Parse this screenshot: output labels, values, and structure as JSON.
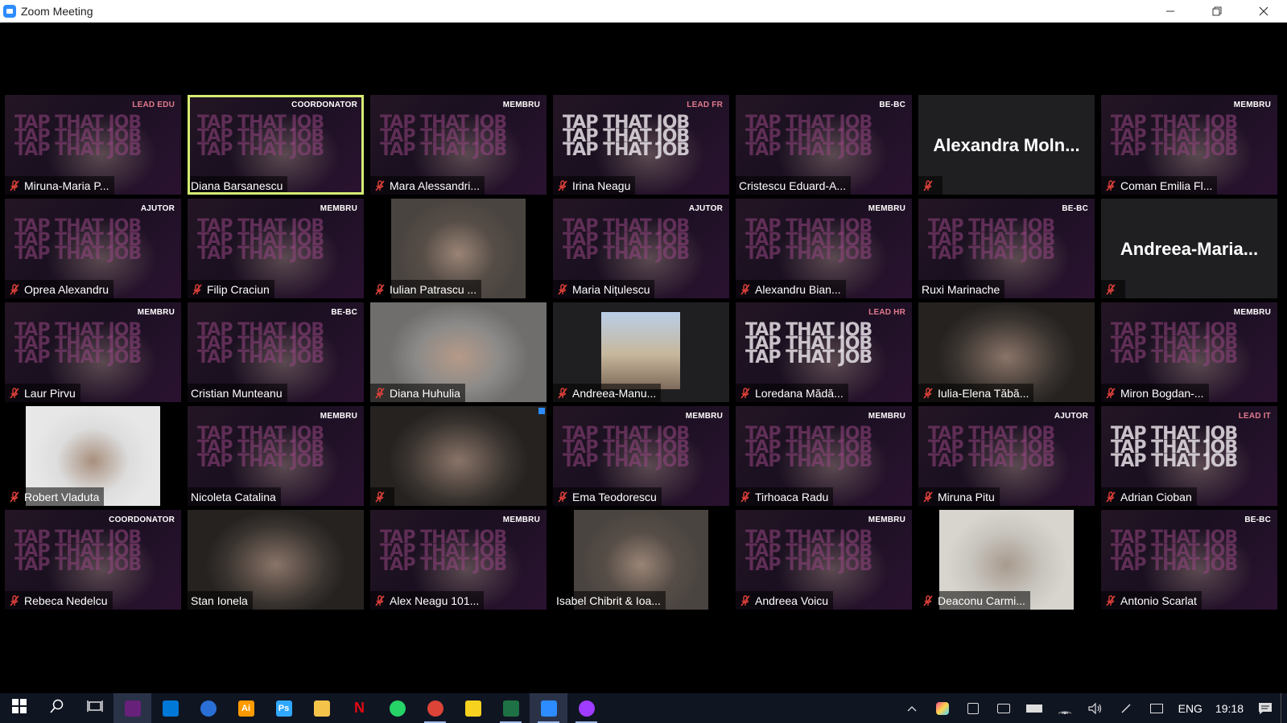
{
  "window": {
    "title": "Zoom Meeting"
  },
  "participants": [
    {
      "name": "Miruna-Maria P...",
      "role": "LEAD EDU",
      "style": "brand",
      "muted": true
    },
    {
      "name": "Diana Barsanescu",
      "role": "COORDONATOR",
      "style": "brand",
      "muted": false,
      "active_speaker": true
    },
    {
      "name": "Mara Alessandri...",
      "role": "MEMBRU",
      "style": "brand",
      "muted": true
    },
    {
      "name": "Irina Neagu",
      "role": "LEAD FR",
      "style": "brand-bright",
      "muted": true
    },
    {
      "name": "Cristescu Eduard-A...",
      "role": "BE-BC",
      "style": "brand",
      "muted": false
    },
    {
      "name": "",
      "display_name": "Alexandra  Moln...",
      "role": "",
      "style": "plain",
      "muted": true
    },
    {
      "name": "Coman Emilia Fl...",
      "role": "MEMBRU",
      "style": "brand",
      "muted": true
    },
    {
      "name": "Oprea Alexandru",
      "role": "AJUTOR",
      "style": "brand",
      "muted": true
    },
    {
      "name": "Filip Craciun",
      "role": "MEMBRU",
      "style": "brand",
      "muted": true
    },
    {
      "name": "Iulian Patrascu ...",
      "role": "",
      "style": "video-narrow2",
      "muted": true
    },
    {
      "name": "Maria Nițulescu",
      "role": "AJUTOR",
      "style": "brand",
      "muted": true
    },
    {
      "name": "Alexandru Bian...",
      "role": "MEMBRU",
      "style": "brand",
      "muted": true
    },
    {
      "name": "Ruxi Marinache",
      "role": "BE-BC",
      "style": "brand",
      "muted": false
    },
    {
      "name": "",
      "display_name": "Andreea-Maria...",
      "role": "",
      "style": "plain",
      "muted": true
    },
    {
      "name": "Laur Pirvu",
      "role": "MEMBRU",
      "style": "brand",
      "muted": true
    },
    {
      "name": "Cristian Munteanu",
      "role": "BE-BC",
      "style": "brand",
      "muted": false
    },
    {
      "name": "Diana Huhulia",
      "role": "",
      "style": "video-light",
      "muted": true
    },
    {
      "name": "Andreea-Manu...",
      "role": "",
      "style": "video-small",
      "muted": true
    },
    {
      "name": "Loredana Mădă...",
      "role": "LEAD HR",
      "style": "brand-bright",
      "muted": true
    },
    {
      "name": "Iulia-Elena Tăbă...",
      "role": "",
      "style": "video",
      "muted": true
    },
    {
      "name": "Miron Bogdan-...",
      "role": "MEMBRU",
      "style": "brand",
      "muted": true
    },
    {
      "name": "Robert Vladuta",
      "role": "",
      "style": "video-narrow",
      "muted": true
    },
    {
      "name": "Nicoleta Catalina",
      "role": "MEMBRU",
      "style": "brand",
      "muted": false
    },
    {
      "name": "",
      "role": "",
      "style": "video",
      "muted": true,
      "badge": true
    },
    {
      "name": "Ema Teodorescu",
      "role": "MEMBRU",
      "style": "brand",
      "muted": true
    },
    {
      "name": "Tirhoaca Radu",
      "role": "MEMBRU",
      "style": "brand",
      "muted": true
    },
    {
      "name": "Miruna Pitu",
      "role": "AJUTOR",
      "style": "brand",
      "muted": true
    },
    {
      "name": "Adrian Cioban",
      "role": "LEAD IT",
      "style": "brand-bright",
      "muted": true
    },
    {
      "name": "Rebeca Nedelcu",
      "role": "COORDONATOR",
      "style": "brand",
      "muted": true
    },
    {
      "name": "Stan Ionela",
      "role": "",
      "style": "video",
      "muted": false
    },
    {
      "name": "Alex Neagu 101...",
      "role": "MEMBRU",
      "style": "brand",
      "muted": true
    },
    {
      "name": "Isabel Chibrit & Ioa...",
      "role": "",
      "style": "video-narrow2",
      "muted": false
    },
    {
      "name": "Andreea Voicu",
      "role": "MEMBRU",
      "style": "brand",
      "muted": true
    },
    {
      "name": "Deaconu Carmi...",
      "role": "",
      "style": "video-narrow3",
      "muted": true
    },
    {
      "name": "Antonio Scarlat",
      "role": "BE-BC",
      "style": "brand",
      "muted": true
    }
  ],
  "brand_text": [
    "TAP",
    "THAT",
    "JOB"
  ],
  "taskbar": {
    "apps": [
      {
        "icon": "windows-start-icon",
        "label": ""
      },
      {
        "icon": "search-icon",
        "label": ""
      },
      {
        "icon": "task-view-icon",
        "label": ""
      },
      {
        "icon": "visual-studio-icon",
        "label": "",
        "color": "#68217a",
        "active": true
      },
      {
        "icon": "vscode-icon",
        "label": "",
        "color": "#0078d7"
      },
      {
        "icon": "app-circle-icon",
        "label": "",
        "color": "#2a6fd6"
      },
      {
        "icon": "illustrator-icon",
        "label": "Ai",
        "color": "#ff9a00"
      },
      {
        "icon": "photoshop-icon",
        "label": "Ps",
        "color": "#31a8ff"
      },
      {
        "icon": "file-explorer-icon",
        "label": "",
        "color": "#f3c34a"
      },
      {
        "icon": "netflix-icon",
        "label": "N",
        "color": "#e50914"
      },
      {
        "icon": "whatsapp-icon",
        "label": "",
        "color": "#25d366"
      },
      {
        "icon": "chrome-icon",
        "label": "",
        "color": "#db4437",
        "running": true
      },
      {
        "icon": "sticky-notes-icon",
        "label": "",
        "color": "#f7d21f"
      },
      {
        "icon": "excel-like-icon",
        "label": "",
        "color": "#1e7145",
        "running": true
      },
      {
        "icon": "zoom-icon",
        "label": "",
        "color": "#2d8cff",
        "active": true,
        "running": true
      },
      {
        "icon": "messenger-icon",
        "label": "",
        "color": "#a03cff",
        "running": true
      }
    ],
    "tray": {
      "lang": "ENG",
      "time": "19:18"
    }
  }
}
